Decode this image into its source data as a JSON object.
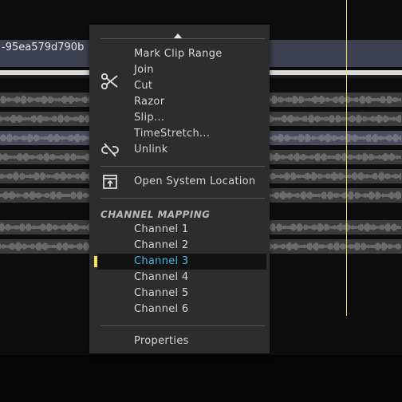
{
  "clip": {
    "title": "-95ea579d790b"
  },
  "menu": {
    "items": [
      {
        "label": "Mark Clip Range"
      },
      {
        "label": "Join"
      },
      {
        "label": "Cut",
        "icon": "scissors-icon"
      },
      {
        "label": "Razor"
      },
      {
        "label": "Slip..."
      },
      {
        "label": "TimeStretch..."
      },
      {
        "label": "Unlink",
        "icon": "unlink-icon"
      },
      {
        "label": "Open System Location",
        "icon": "open-location-icon"
      }
    ],
    "section_title": "CHANNEL MAPPING",
    "channels": [
      {
        "label": "Channel 1"
      },
      {
        "label": "Channel 2"
      },
      {
        "label": "Channel 3",
        "selected": true
      },
      {
        "label": "Channel 4"
      },
      {
        "label": "Channel 5"
      },
      {
        "label": "Channel 6"
      }
    ],
    "properties": {
      "label": "Properties"
    }
  },
  "colors": {
    "accent": "#3fb6e6",
    "playhead": "#f3e25a",
    "menu_bg": "#2d2d2d"
  }
}
